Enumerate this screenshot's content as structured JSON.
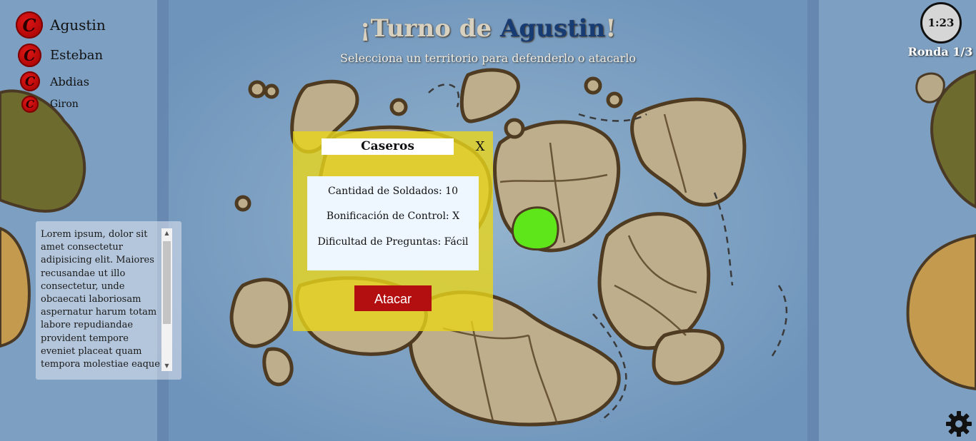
{
  "header": {
    "title_prefix": "¡Turno de ",
    "current_player": "Agustin",
    "title_suffix": "!",
    "subtitle": "Selecciona un territorio para defenderlo o atacarlo"
  },
  "players": [
    {
      "name": "Agustin",
      "badge": "C",
      "color": "#c40000"
    },
    {
      "name": "Esteban",
      "badge": "C",
      "color": "#c40000"
    },
    {
      "name": "Abdias",
      "badge": "C",
      "color": "#c40000"
    },
    {
      "name": "Giron",
      "badge": "C",
      "color": "#c40000"
    }
  ],
  "timer": {
    "value": "1:23"
  },
  "round": {
    "label": "Ronda 1/3"
  },
  "log": {
    "text": "Lorem ipsum, dolor sit amet consectetur adipisicing elit. Maiores recusandae ut illo consectetur, unde obcaecati laboriosam aspernatur harum totam labore repudiandae provident tempore eveniet placeat quam tempora molestiae eaque"
  },
  "territory_modal": {
    "name": "Caseros",
    "close_label": "X",
    "soldiers": "Cantidad de Soldados: 10",
    "control_bonus": "Bonificación de Control: X",
    "difficulty": "Dificultad de Preguntas: Fácil",
    "attack_label": "Atacar",
    "background_color": "#e9d51c",
    "attack_color": "#b40f10"
  },
  "map": {
    "selected_territory_color": "#5ee61a",
    "sea_color": "#7fa3c3",
    "land_color": "#bfae8b"
  },
  "icons": {
    "settings": "gear-icon",
    "player_badge": "circle-c-icon"
  }
}
